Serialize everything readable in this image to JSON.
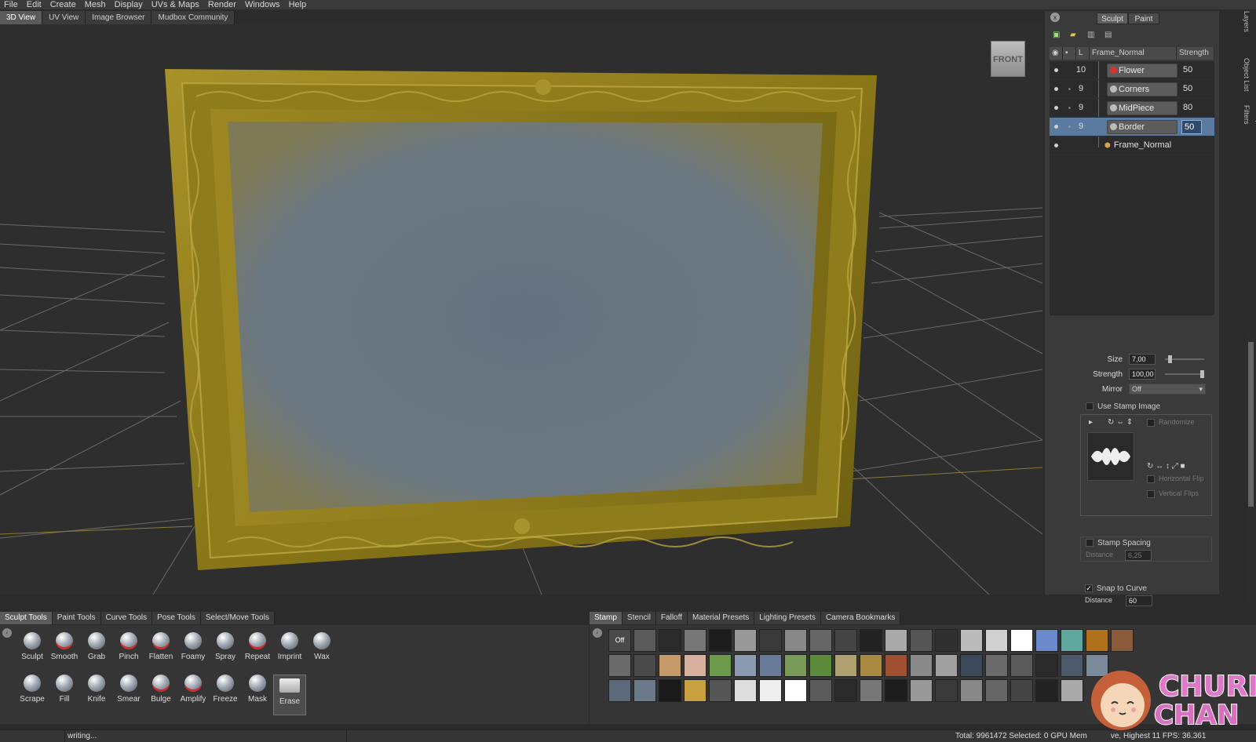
{
  "menu": [
    "File",
    "Edit",
    "Create",
    "Mesh",
    "Display",
    "UVs & Maps",
    "Render",
    "Windows",
    "Help"
  ],
  "view_tabs": [
    {
      "label": "3D View",
      "active": true
    },
    {
      "label": "UV View",
      "active": false
    },
    {
      "label": "Image Browser",
      "active": false
    },
    {
      "label": "Mudbox Community",
      "active": false
    }
  ],
  "viewcube": {
    "label": "FRONT"
  },
  "right_panel": {
    "close_label": "x",
    "tabs": [
      {
        "label": "Sculpt",
        "active": true
      },
      {
        "label": "Paint",
        "active": false
      }
    ],
    "side_tabs": [
      "Layers",
      "Object List",
      "Viewport Filters"
    ],
    "layer_header": {
      "mesh": "Frame_Normal",
      "strength_label": "Strength",
      "l_label": "L"
    },
    "layers": [
      {
        "level": "10",
        "name": "Flower",
        "strength": "50",
        "icon": "red-dot",
        "selected": false
      },
      {
        "level": "9",
        "name": "Corners",
        "strength": "50",
        "icon": "gray-dot",
        "selected": false
      },
      {
        "level": "9",
        "name": "MidPiece",
        "strength": "80",
        "icon": "gray-dot",
        "selected": false
      },
      {
        "level": "9",
        "name": "Border",
        "strength": "50",
        "icon": "gray-dot",
        "selected": true
      }
    ],
    "base_layer": "Frame_Normal"
  },
  "properties": {
    "size_label": "Size",
    "size_value": "7,00",
    "size_fraction": 0.08,
    "strength_label": "Strength",
    "strength_value": "100,00",
    "strength_fraction": 1.0,
    "mirror_label": "Mirror",
    "mirror_value": "Off",
    "use_stamp_image": "Use Stamp Image",
    "randomize": "Randomize",
    "horizontal_flip": "Horizontal Flip",
    "vertical_flips": "Vertical Flips",
    "stamp_spacing": "Stamp Spacing",
    "distance_label": "Distance",
    "distance_value": "6,25",
    "snap_to_curve": "Snap to Curve",
    "snap_checked": true,
    "snap_distance_label": "Distance",
    "snap_distance_value": "60"
  },
  "tool_tabs": [
    {
      "label": "Sculpt Tools",
      "active": true
    },
    {
      "label": "Paint Tools",
      "active": false
    },
    {
      "label": "Curve Tools",
      "active": false
    },
    {
      "label": "Pose Tools",
      "active": false
    },
    {
      "label": "Select/Move Tools",
      "active": false
    }
  ],
  "tools_row1": [
    "Sculpt",
    "Smooth",
    "Grab",
    "Pinch",
    "Flatten",
    "Foamy",
    "Spray",
    "Repeat",
    "Imprint",
    "Wax"
  ],
  "tools_row2": [
    "Scrape",
    "Fill",
    "Knife",
    "Smear",
    "Bulge",
    "Amplify",
    "Freeze",
    "Mask",
    "Erase"
  ],
  "selected_tool": "Erase",
  "tray_tabs": [
    {
      "label": "Stamp",
      "active": true
    },
    {
      "label": "Stencil",
      "active": false
    },
    {
      "label": "Falloff",
      "active": false
    },
    {
      "label": "Material Presets",
      "active": false
    },
    {
      "label": "Lighting Presets",
      "active": false
    },
    {
      "label": "Camera Bookmarks",
      "active": false
    }
  ],
  "stamp_off_label": "Off",
  "status": {
    "message": "writing...",
    "stats": "Total: 9961472  Selected: 0 GPU Mem"
  },
  "stats_tail": "ve, Highest 11 FPS: 36.361",
  "logo_text": [
    "CHURI",
    "CHAN"
  ],
  "colors": {
    "accent_selected": "#5a7aa0",
    "frame_gold": "#8a7a1e",
    "grid": "#6a6a6a"
  }
}
